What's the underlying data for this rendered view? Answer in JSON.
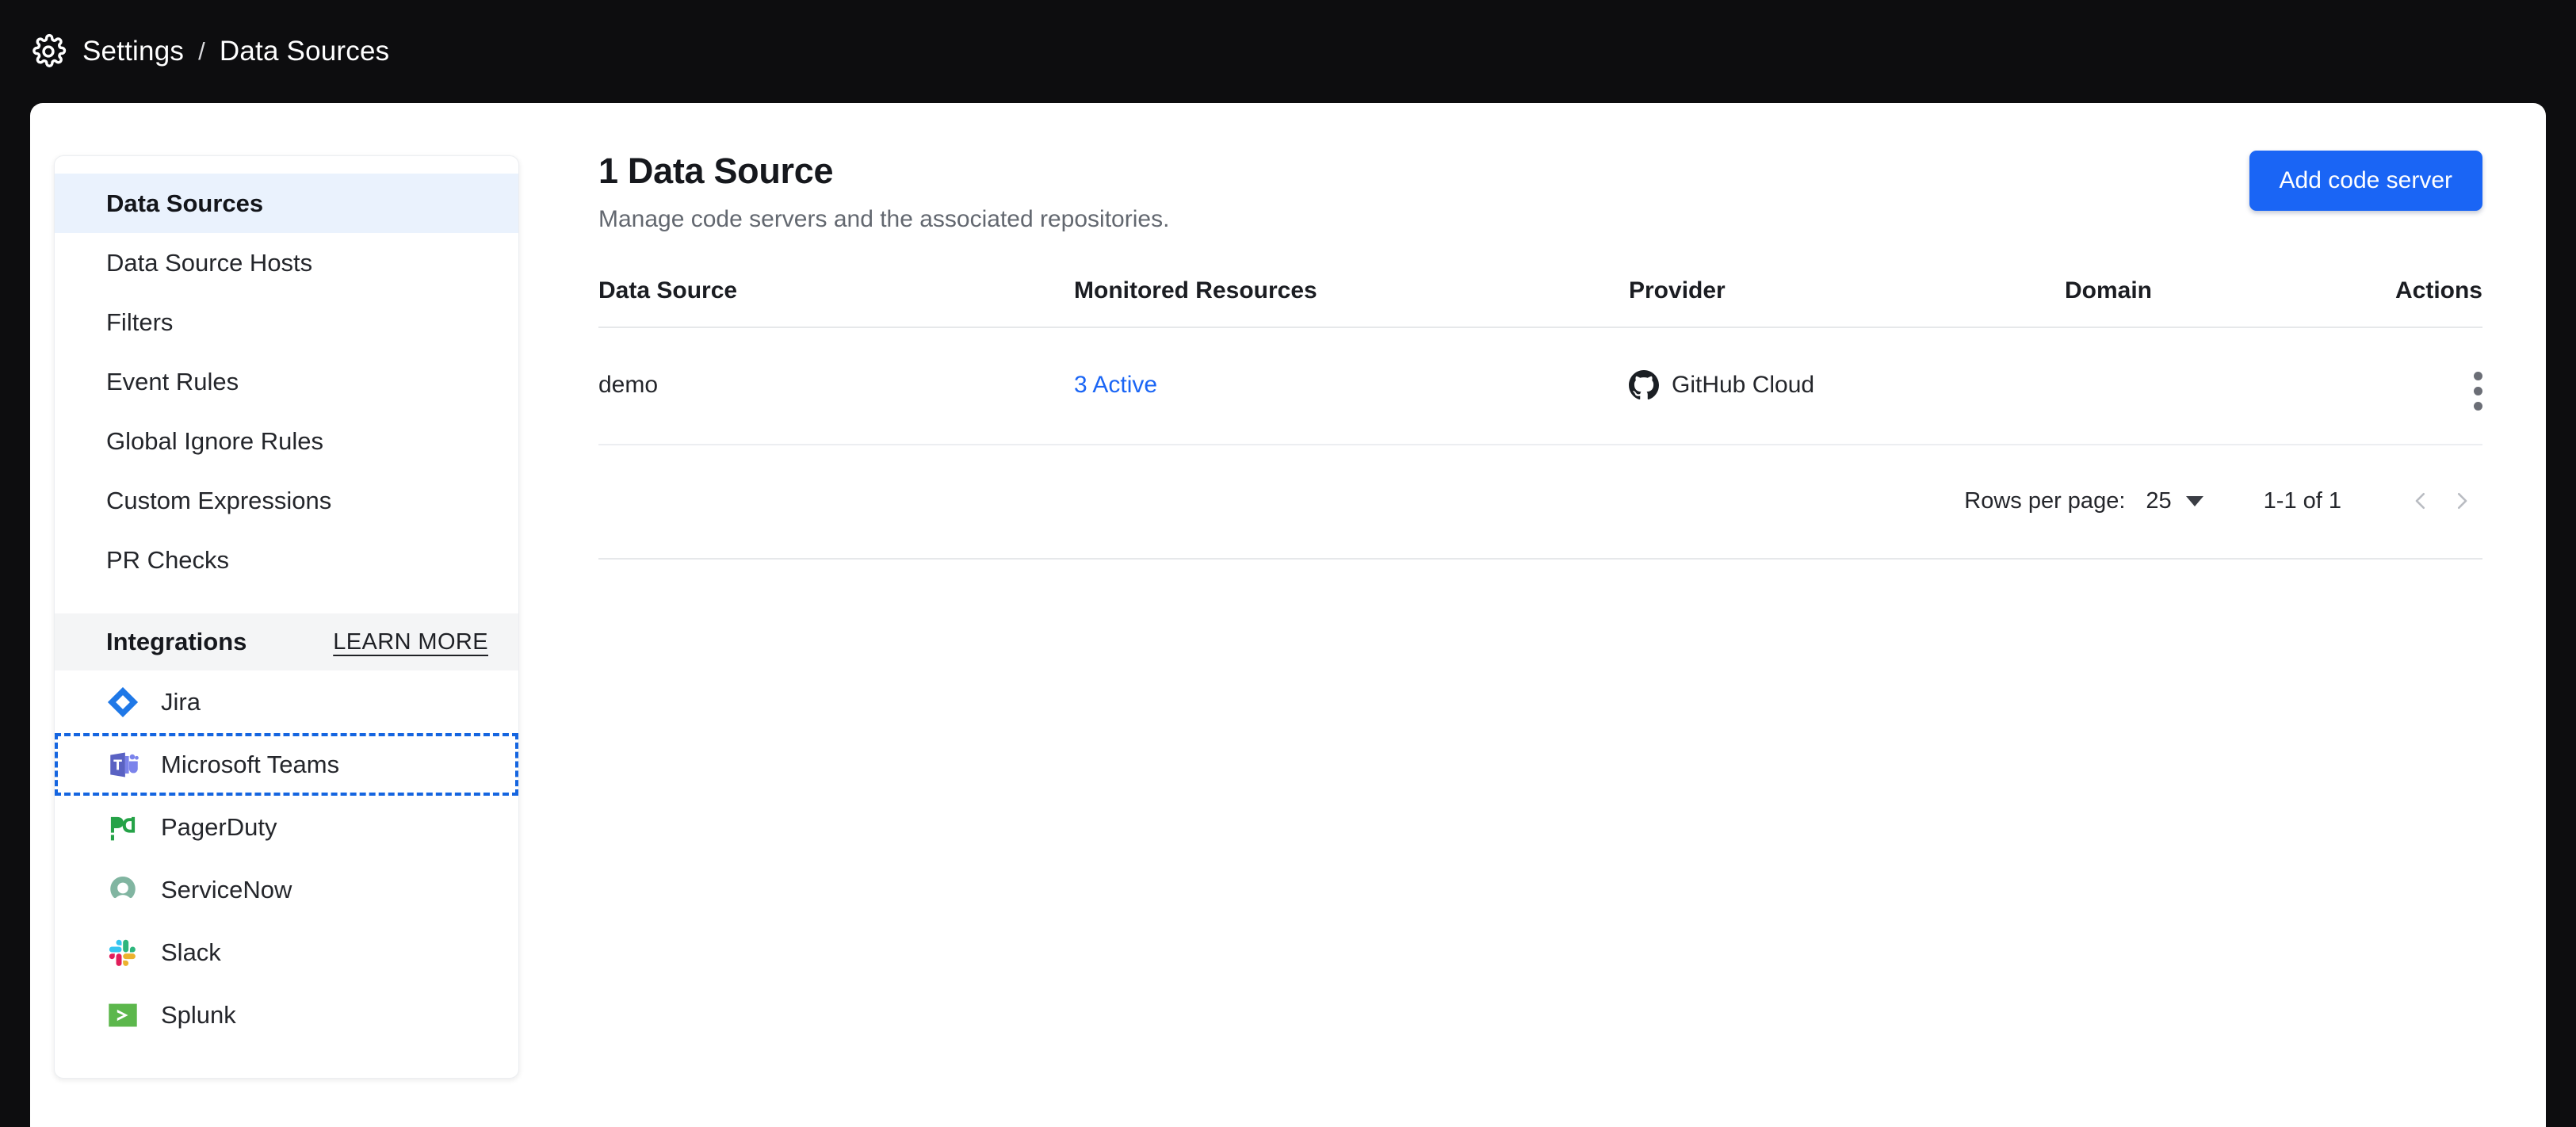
{
  "header": {
    "gear_icon": "gear-icon",
    "breadcrumb": {
      "root": "Settings",
      "separator": "/",
      "current": "Data Sources"
    }
  },
  "sidebar": {
    "nav_items": [
      {
        "label": "Data Sources",
        "active": true
      },
      {
        "label": "Data Source Hosts",
        "active": false
      },
      {
        "label": "Filters",
        "active": false
      },
      {
        "label": "Event Rules",
        "active": false
      },
      {
        "label": "Global Ignore Rules",
        "active": false
      },
      {
        "label": "Custom Expressions",
        "active": false
      },
      {
        "label": "PR Checks",
        "active": false
      }
    ],
    "integrations": {
      "title": "Integrations",
      "learn_more": "LEARN MORE",
      "items": [
        {
          "label": "Jira",
          "icon": "jira-icon",
          "focused": false
        },
        {
          "label": "Microsoft Teams",
          "icon": "microsoft-teams-icon",
          "focused": true
        },
        {
          "label": "PagerDuty",
          "icon": "pagerduty-icon",
          "focused": false
        },
        {
          "label": "ServiceNow",
          "icon": "servicenow-icon",
          "focused": false
        },
        {
          "label": "Slack",
          "icon": "slack-icon",
          "focused": false
        },
        {
          "label": "Splunk",
          "icon": "splunk-icon",
          "focused": false
        }
      ]
    }
  },
  "main": {
    "title": "1 Data Source",
    "subtitle": "Manage code servers and the associated repositories.",
    "add_button": "Add code server",
    "table": {
      "columns": [
        "Data Source",
        "Monitored Resources",
        "Provider",
        "Domain",
        "Actions"
      ],
      "rows": [
        {
          "data_source": "demo",
          "monitored_resources": "3 Active",
          "provider": "GitHub Cloud",
          "provider_icon": "github-icon",
          "domain": "",
          "actions_icon": "more-vertical-icon"
        }
      ]
    },
    "pagination": {
      "rows_per_page_label": "Rows per page:",
      "rows_per_page_value": "25",
      "range": "1-1 of 1",
      "prev_icon": "chevron-left-icon",
      "next_icon": "chevron-right-icon"
    }
  },
  "colors": {
    "accent_blue": "#1a65f5",
    "focus_outline": "#1565e0",
    "active_nav_bg": "#eaf2fd",
    "app_background": "#0d0d0f"
  }
}
